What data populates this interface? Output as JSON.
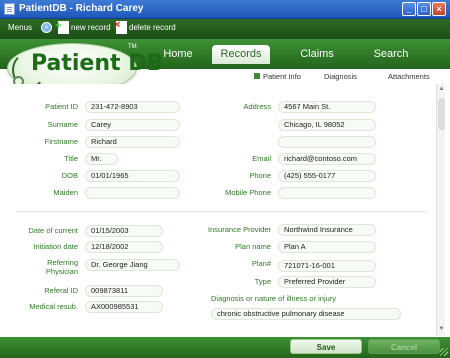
{
  "window": {
    "title": "PatientDB - Richard Carey",
    "controls": {
      "minimize": "_",
      "maximize": "□",
      "close": "×"
    }
  },
  "toolbar": {
    "menus_label": "Menus",
    "new_record_label": "new record",
    "delete_record_label": "delete record",
    "menu_arrow": "»"
  },
  "logo": {
    "text": "Patient DB",
    "tm": "TM"
  },
  "tabs": [
    {
      "label": "Home",
      "active": false
    },
    {
      "label": "Records",
      "active": true
    },
    {
      "label": "Claims",
      "active": false
    },
    {
      "label": "Search",
      "active": false
    }
  ],
  "subtabs": [
    {
      "label": "Patient Info",
      "active": true
    },
    {
      "label": "Diagnosis",
      "active": false
    },
    {
      "label": "Attachments",
      "active": false
    }
  ],
  "patient": {
    "labels": {
      "patient_id": "Patient ID",
      "surname": "Surname",
      "firstname": "Firstname",
      "title": "Title",
      "dob": "DOB",
      "maiden": "Maiden",
      "address": "Address",
      "email": "Email",
      "phone": "Phone",
      "mobile_phone": "Mobile Phone"
    },
    "values": {
      "patient_id": "231-472-8903",
      "surname": "Carey",
      "firstname": "Richard",
      "title": "Mr.",
      "dob": "01/01/1965",
      "maiden": "",
      "address_line1": "4567 Main St.",
      "address_line2": "Chicago, IL 98052",
      "address_line3": "",
      "email": "richard@contoso.com",
      "phone": "(425) 555-0177",
      "mobile_phone": ""
    }
  },
  "claim": {
    "labels": {
      "date_of_current": "Date of current",
      "initiation_date": "Initiation date",
      "referring_physician": "Referring Physician",
      "referral_id": "Referal ID",
      "medical_resub": "Medical resub.",
      "insurance_provider": "Insurance Provider",
      "plan_name": "Plan name",
      "plan_number": "Plan#",
      "type": "Type",
      "diagnosis": "Diagnosis or nature of illness or injury"
    },
    "values": {
      "date_of_current": "01/15/2003",
      "initiation_date": "12/18/2002",
      "referring_physician": "Dr. George Jiang",
      "referral_id": "009873811",
      "medical_resub": "AX000985531",
      "insurance_provider": "Northwind Insurance",
      "plan_name": "Plan A",
      "plan_number": "721071-16-001",
      "type": "Preferred Provider",
      "diagnosis": "chronic obstructive pulmonary disease"
    }
  },
  "footer": {
    "save_label": "Save",
    "cancel_label": "Cancel"
  },
  "colors": {
    "brand_green": "#23641b",
    "label_green": "#2e7a24",
    "titlebar_blue": "#1e56b8"
  }
}
